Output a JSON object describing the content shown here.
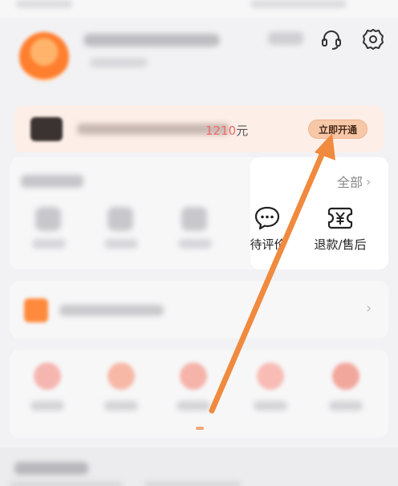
{
  "vip_banner": {
    "amount": "1210",
    "unit": "元",
    "cta_label": "立即开通"
  },
  "orders": {
    "all_label": "全部",
    "items": [
      {
        "label": ""
      },
      {
        "label": ""
      },
      {
        "label": ""
      },
      {
        "label": "待评价"
      },
      {
        "label": "退款/售后"
      }
    ]
  },
  "icons": {
    "headset": "headset-icon",
    "settings": "gear-icon",
    "chat": "chat-bubble-icon",
    "refund": "refund-yen-icon",
    "chevron": "chevron-right-icon"
  },
  "colors": {
    "accent_orange": "#f08a3e",
    "price_red": "#f06a6a",
    "vip_bg": "#fdeee7",
    "vip_button": "#f6c8a8"
  }
}
